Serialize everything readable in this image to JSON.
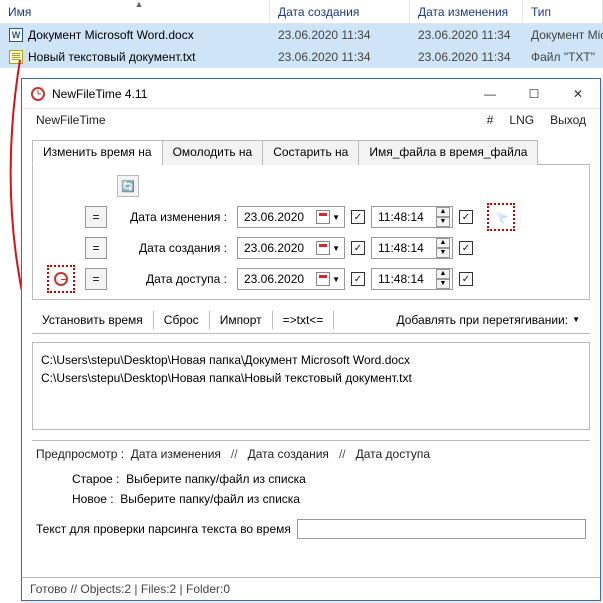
{
  "explorer": {
    "columns": {
      "name": "Имя",
      "created": "Дата создания",
      "modified": "Дата изменения",
      "type": "Тип"
    },
    "rows": [
      {
        "icon": "word",
        "name": "Документ Microsoft Word.docx",
        "created": "23.06.2020 11:34",
        "modified": "23.06.2020 11:34",
        "type": "Документ Micros"
      },
      {
        "icon": "txt",
        "name": "Новый текстовый документ.txt",
        "created": "23.06.2020 11:34",
        "modified": "23.06.2020 11:34",
        "type": "Файл \"TXT\""
      }
    ]
  },
  "window": {
    "title": "NewFileTime 4.11",
    "menu": {
      "left": "NewFileTime",
      "hash": "#",
      "lng": "LNG",
      "exit": "Выход"
    },
    "tabs": {
      "change": "Изменить время на",
      "younger": "Омолодить на",
      "older": "Состарить на",
      "name2time": "Имя_файла в время_файла"
    },
    "rows": {
      "eq": "=",
      "modified_label": "Дата изменения :",
      "created_label": "Дата создания :",
      "accessed_label": "Дата доступа :",
      "date": "23.06.2020",
      "time": "11:48:14"
    },
    "actions": {
      "set": "Установить время",
      "reset": "Сброс",
      "import": "Импорт",
      "txt": "=>txt<=",
      "drop": "Добавлять при перетягивании:"
    },
    "files": [
      "C:\\Users\\stepu\\Desktop\\Новая папка\\Документ Microsoft Word.docx",
      "C:\\Users\\stepu\\Desktop\\Новая папка\\Новый текстовый документ.txt"
    ],
    "preview": {
      "label": "Предпросмотр :",
      "modified": "Дата изменения",
      "created": "Дата создания",
      "accessed": "Дата доступа",
      "slash": "//",
      "old_label": "Старое :",
      "new_label": "Новое :",
      "placeholder_msg": "Выберите папку/файл из списка",
      "parse_label": "Текст для проверки парсинга текста во время",
      "parse_value": ""
    },
    "status": "Готово // Objects:2 | Files:2 | Folder:0"
  }
}
